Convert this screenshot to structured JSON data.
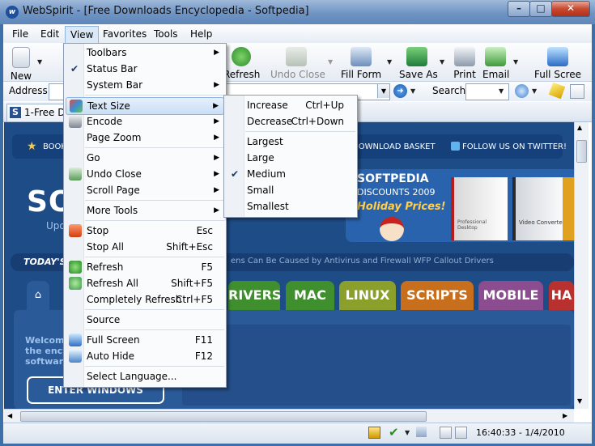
{
  "window": {
    "title": "WebSpirit - [Free Downloads Encyclopedia - Softpedia]",
    "min": "–",
    "max": "□",
    "close": "✕"
  },
  "menubar": [
    "File",
    "Edit",
    "View",
    "Favorites",
    "Tools",
    "Help"
  ],
  "toolbar": {
    "new": "New",
    "refresh": "Refresh",
    "undo_close": "Undo Close",
    "fill_form": "Fill Form",
    "save_as": "Save As",
    "print": "Print",
    "email": "Email",
    "full_screen": "Full Scree"
  },
  "address": {
    "label": "Address",
    "search_label": "Search"
  },
  "tab": {
    "title": "1-Free Do"
  },
  "site": {
    "top_links": [
      "BOOK",
      "DOWNLOAD BASKET",
      "FOLLOW US ON TWITTER!"
    ],
    "logo_text": "SO",
    "logo_sub": "Upo",
    "discounts": {
      "brand": "SOFTPEDIA",
      "sub": "DISCOUNTS 2009",
      "holiday": "Holiday Prices!"
    },
    "products": [
      "Professional Desktop",
      "Video Converter"
    ],
    "today": "TODAY'S",
    "ticker": "ens Can Be Caused by Antivirus and Firewall WFP Callout Drivers",
    "nav_tabs": [
      "RIVERS",
      "MAC",
      "LINUX",
      "SCRIPTS",
      "MOBILE",
      "HA"
    ],
    "welcome": [
      "Welcom",
      "the ency",
      "softwar"
    ],
    "enter_button": "ENTER WINDOWS"
  },
  "view_menu": [
    {
      "label": "Toolbars",
      "sub": true
    },
    {
      "label": "Status Bar",
      "checked": true
    },
    {
      "label": "System Bar",
      "sub": true
    },
    {
      "sep": true
    },
    {
      "label": "Text Size",
      "sub": true,
      "highlight": true,
      "icon": "text-size-icon"
    },
    {
      "label": "Encode",
      "sub": true,
      "icon": "encode-icon"
    },
    {
      "label": "Page Zoom",
      "sub": true
    },
    {
      "sep": true
    },
    {
      "label": "Go",
      "sub": true
    },
    {
      "label": "Undo Close",
      "sub": true,
      "icon": "undo-close-icon"
    },
    {
      "label": "Scroll Page",
      "sub": true
    },
    {
      "sep": true
    },
    {
      "label": "More Tools",
      "sub": true
    },
    {
      "sep": true
    },
    {
      "label": "Stop",
      "shortcut": "Esc",
      "icon": "stop-icon"
    },
    {
      "label": "Stop All",
      "shortcut": "Shift+Esc"
    },
    {
      "sep": true
    },
    {
      "label": "Refresh",
      "shortcut": "F5",
      "icon": "refresh-icon"
    },
    {
      "label": "Refresh All",
      "shortcut": "Shift+F5",
      "icon": "refresh-all-icon"
    },
    {
      "label": "Completely Refresh",
      "shortcut": "Ctrl+F5"
    },
    {
      "sep": true
    },
    {
      "label": "Source"
    },
    {
      "sep": true
    },
    {
      "label": "Full Screen",
      "shortcut": "F11",
      "icon": "full-screen-icon"
    },
    {
      "label": "Auto Hide",
      "shortcut": "F12",
      "icon": "auto-hide-icon"
    },
    {
      "sep": true
    },
    {
      "label": "Select Language..."
    }
  ],
  "text_size_menu": [
    {
      "label": "Increase",
      "shortcut": "Ctrl+Up"
    },
    {
      "label": "Decrease",
      "shortcut": "Ctrl+Down"
    },
    {
      "sep": true
    },
    {
      "label": "Largest"
    },
    {
      "label": "Large"
    },
    {
      "label": "Medium",
      "checked": true
    },
    {
      "label": "Small"
    },
    {
      "label": "Smallest"
    }
  ],
  "status": {
    "time": "16:40:33 - 1/4/2010"
  },
  "colors": {
    "title_grad": "#6f94c4",
    "site_bg": "#1e4c86",
    "menu_hl": "#c9def5",
    "tab_green": "#3f8f2f",
    "tab_olive": "#8aa02a",
    "tab_orange": "#c86f1e",
    "tab_purple": "#8b4d8f",
    "tab_red": "#b8312f"
  }
}
